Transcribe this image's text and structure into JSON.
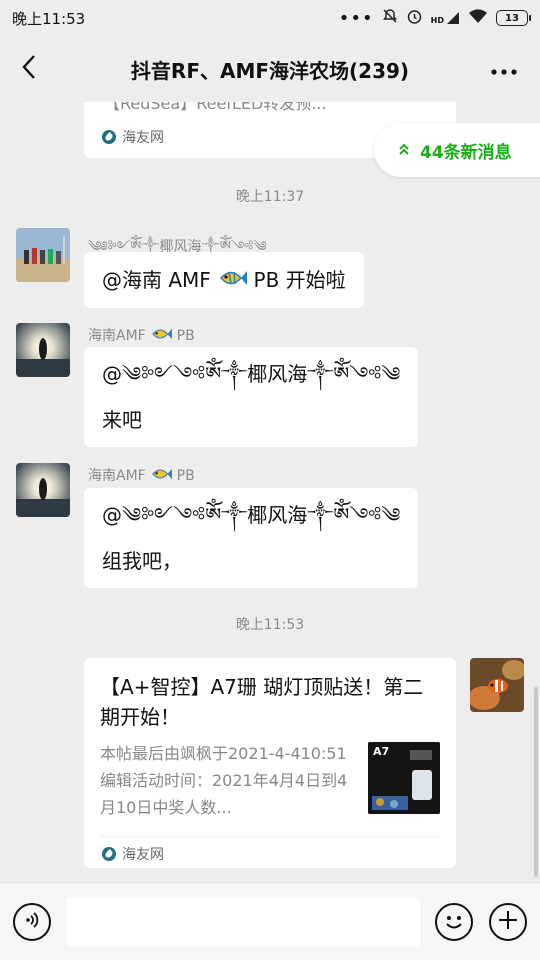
{
  "status_bar": {
    "time": "晚上11:53",
    "battery": "13",
    "icons": [
      "dots-icon",
      "mute-icon",
      "alarm-icon",
      "hd-signal-icon",
      "wifi-icon",
      "battery-icon"
    ]
  },
  "header": {
    "title": "抖音RF、AMF海洋农场(239)",
    "back_icon": "chevron-left-icon",
    "more_icon": "more-horizontal-icon"
  },
  "new_messages": {
    "label": "44条新消息",
    "icon": "double-chevron-up-icon",
    "accent": "#1aad19"
  },
  "messages": [
    {
      "type": "link_card_partial",
      "title_fragment": "【RedSea】ReefLED转发预...",
      "source": "海友网"
    },
    {
      "type": "time",
      "text": "晚上11:37"
    },
    {
      "type": "text",
      "sender": "༄༅༻ཨོཾ༒椰风海༒ཨོཾ༺༄",
      "text_pre": "@海南 AMF",
      "text_post": "PB  开始啦"
    },
    {
      "type": "text",
      "sender_pre": "海南AMF",
      "sender_post": "PB",
      "line1": "@༄༻༺ཨོཾ༒椰风海༒ཨོཾ༺༄",
      "line2": "来吧"
    },
    {
      "type": "text",
      "sender_pre": "海南AMF",
      "sender_post": "PB",
      "line1": "@༄༻༺ཨོཾ༒椰风海༒ཨོཾ༺༄",
      "line2": "组我吧，"
    },
    {
      "type": "time",
      "text": "晚上11:53"
    },
    {
      "type": "link_card",
      "title": "【A+智控】A7珊 瑚灯顶贴送！第二期开始！",
      "description": "本帖最后由飒枫于2021-4-410:51编辑活动时间：2021年4月4日到4月10日中奖人数...",
      "thumb_label": "A7",
      "source": "海友网"
    }
  ],
  "input_bar": {
    "voice_icon": "voice-icon",
    "emoji_icon": "emoji-icon",
    "plus_icon": "plus-icon"
  }
}
